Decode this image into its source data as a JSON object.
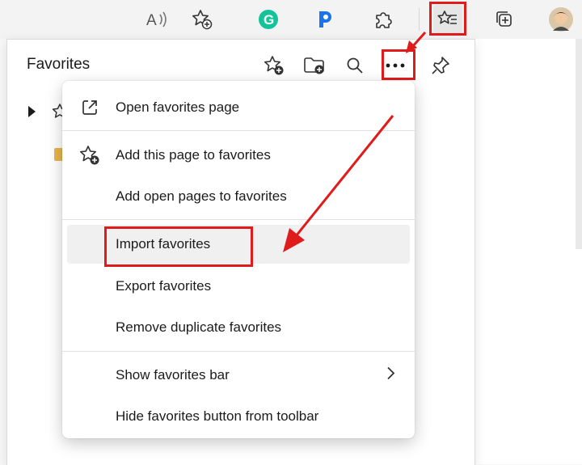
{
  "toolbar": {
    "icons": [
      "read-aloud-icon",
      "add-favorite-icon",
      "grammarly-icon",
      "p-extension-icon",
      "extensions-icon",
      "favorites-icon",
      "collections-icon",
      "profile-avatar"
    ]
  },
  "favorites_panel": {
    "title": "Favorites",
    "actions": [
      "add-favorite-icon",
      "add-folder-icon",
      "search-icon",
      "more-options-icon",
      "pin-icon"
    ]
  },
  "menu": {
    "items": [
      {
        "label": "Open favorites page",
        "icon": "open-external-icon"
      },
      {
        "label": "Add this page to favorites",
        "icon": "add-favorite-icon"
      },
      {
        "label": "Add open pages to favorites",
        "icon": ""
      },
      {
        "label": "Import favorites",
        "icon": ""
      },
      {
        "label": "Export favorites",
        "icon": ""
      },
      {
        "label": "Remove duplicate favorites",
        "icon": ""
      },
      {
        "label": "Show favorites bar",
        "icon": "chevron-right-icon"
      },
      {
        "label": "Hide favorites button from toolbar",
        "icon": ""
      }
    ]
  },
  "colors": {
    "highlight": "#e01b1b",
    "grammarly": "#15c39a",
    "p_extension": "#1a73e8",
    "folder": "#e8b54a"
  }
}
